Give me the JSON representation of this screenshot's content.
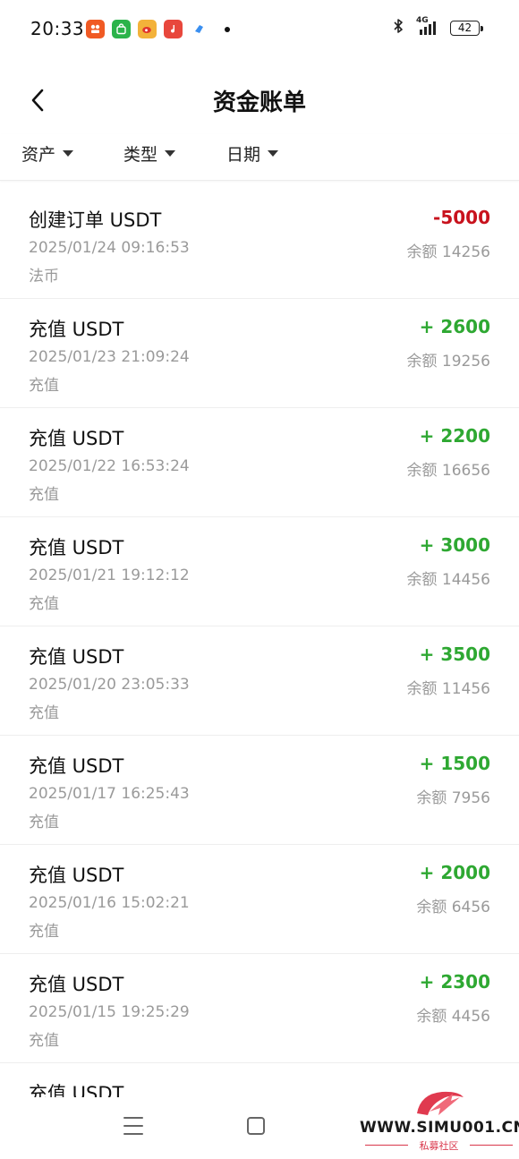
{
  "status_bar": {
    "time": "20:33",
    "network": "4G",
    "battery": "42",
    "app_icons": [
      {
        "name": "taobao-icon",
        "color": "#f05a24"
      },
      {
        "name": "shopping-bag-icon",
        "color": "#2bb34a"
      },
      {
        "name": "weibo-icon",
        "color": "#f3b23a"
      },
      {
        "name": "music-icon",
        "color": "#e8473c"
      },
      {
        "name": "cloud-app-icon",
        "color": "#3a8ff0"
      }
    ]
  },
  "header": {
    "title": "资金账单"
  },
  "filters": [
    {
      "label": "资产"
    },
    {
      "label": "类型"
    },
    {
      "label": "日期"
    }
  ],
  "transactions": [
    {
      "title": "创建订单 USDT",
      "amount": "-5000",
      "direction": "negative",
      "time": "2025/01/24 09:16:53",
      "balance": "余额 14256",
      "category": "法币"
    },
    {
      "title": "充值 USDT",
      "amount": "+ 2600",
      "direction": "positive",
      "time": "2025/01/23 21:09:24",
      "balance": "余额 19256",
      "category": "充值"
    },
    {
      "title": "充值 USDT",
      "amount": "+ 2200",
      "direction": "positive",
      "time": "2025/01/22 16:53:24",
      "balance": "余额 16656",
      "category": "充值"
    },
    {
      "title": "充值 USDT",
      "amount": "+ 3000",
      "direction": "positive",
      "time": "2025/01/21 19:12:12",
      "balance": "余额 14456",
      "category": "充值"
    },
    {
      "title": "充值 USDT",
      "amount": "+ 3500",
      "direction": "positive",
      "time": "2025/01/20 23:05:33",
      "balance": "余额 11456",
      "category": "充值"
    },
    {
      "title": "充值 USDT",
      "amount": "+ 1500",
      "direction": "positive",
      "time": "2025/01/17 16:25:43",
      "balance": "余额 7956",
      "category": "充值"
    },
    {
      "title": "充值 USDT",
      "amount": "+ 2000",
      "direction": "positive",
      "time": "2025/01/16 15:02:21",
      "balance": "余额 6456",
      "category": "充值"
    },
    {
      "title": "充值 USDT",
      "amount": "+ 2300",
      "direction": "positive",
      "time": "2025/01/15 19:25:29",
      "balance": "余额 4456",
      "category": "充值"
    }
  ],
  "partial_transaction": {
    "title": "充值 USDT"
  },
  "watermark": {
    "site": "WWW.SIMU001.CN",
    "subtitle": "私募社区"
  },
  "colors": {
    "negative": "#c8121d",
    "positive": "#2ea832",
    "muted_text": "#9a9a9a"
  }
}
